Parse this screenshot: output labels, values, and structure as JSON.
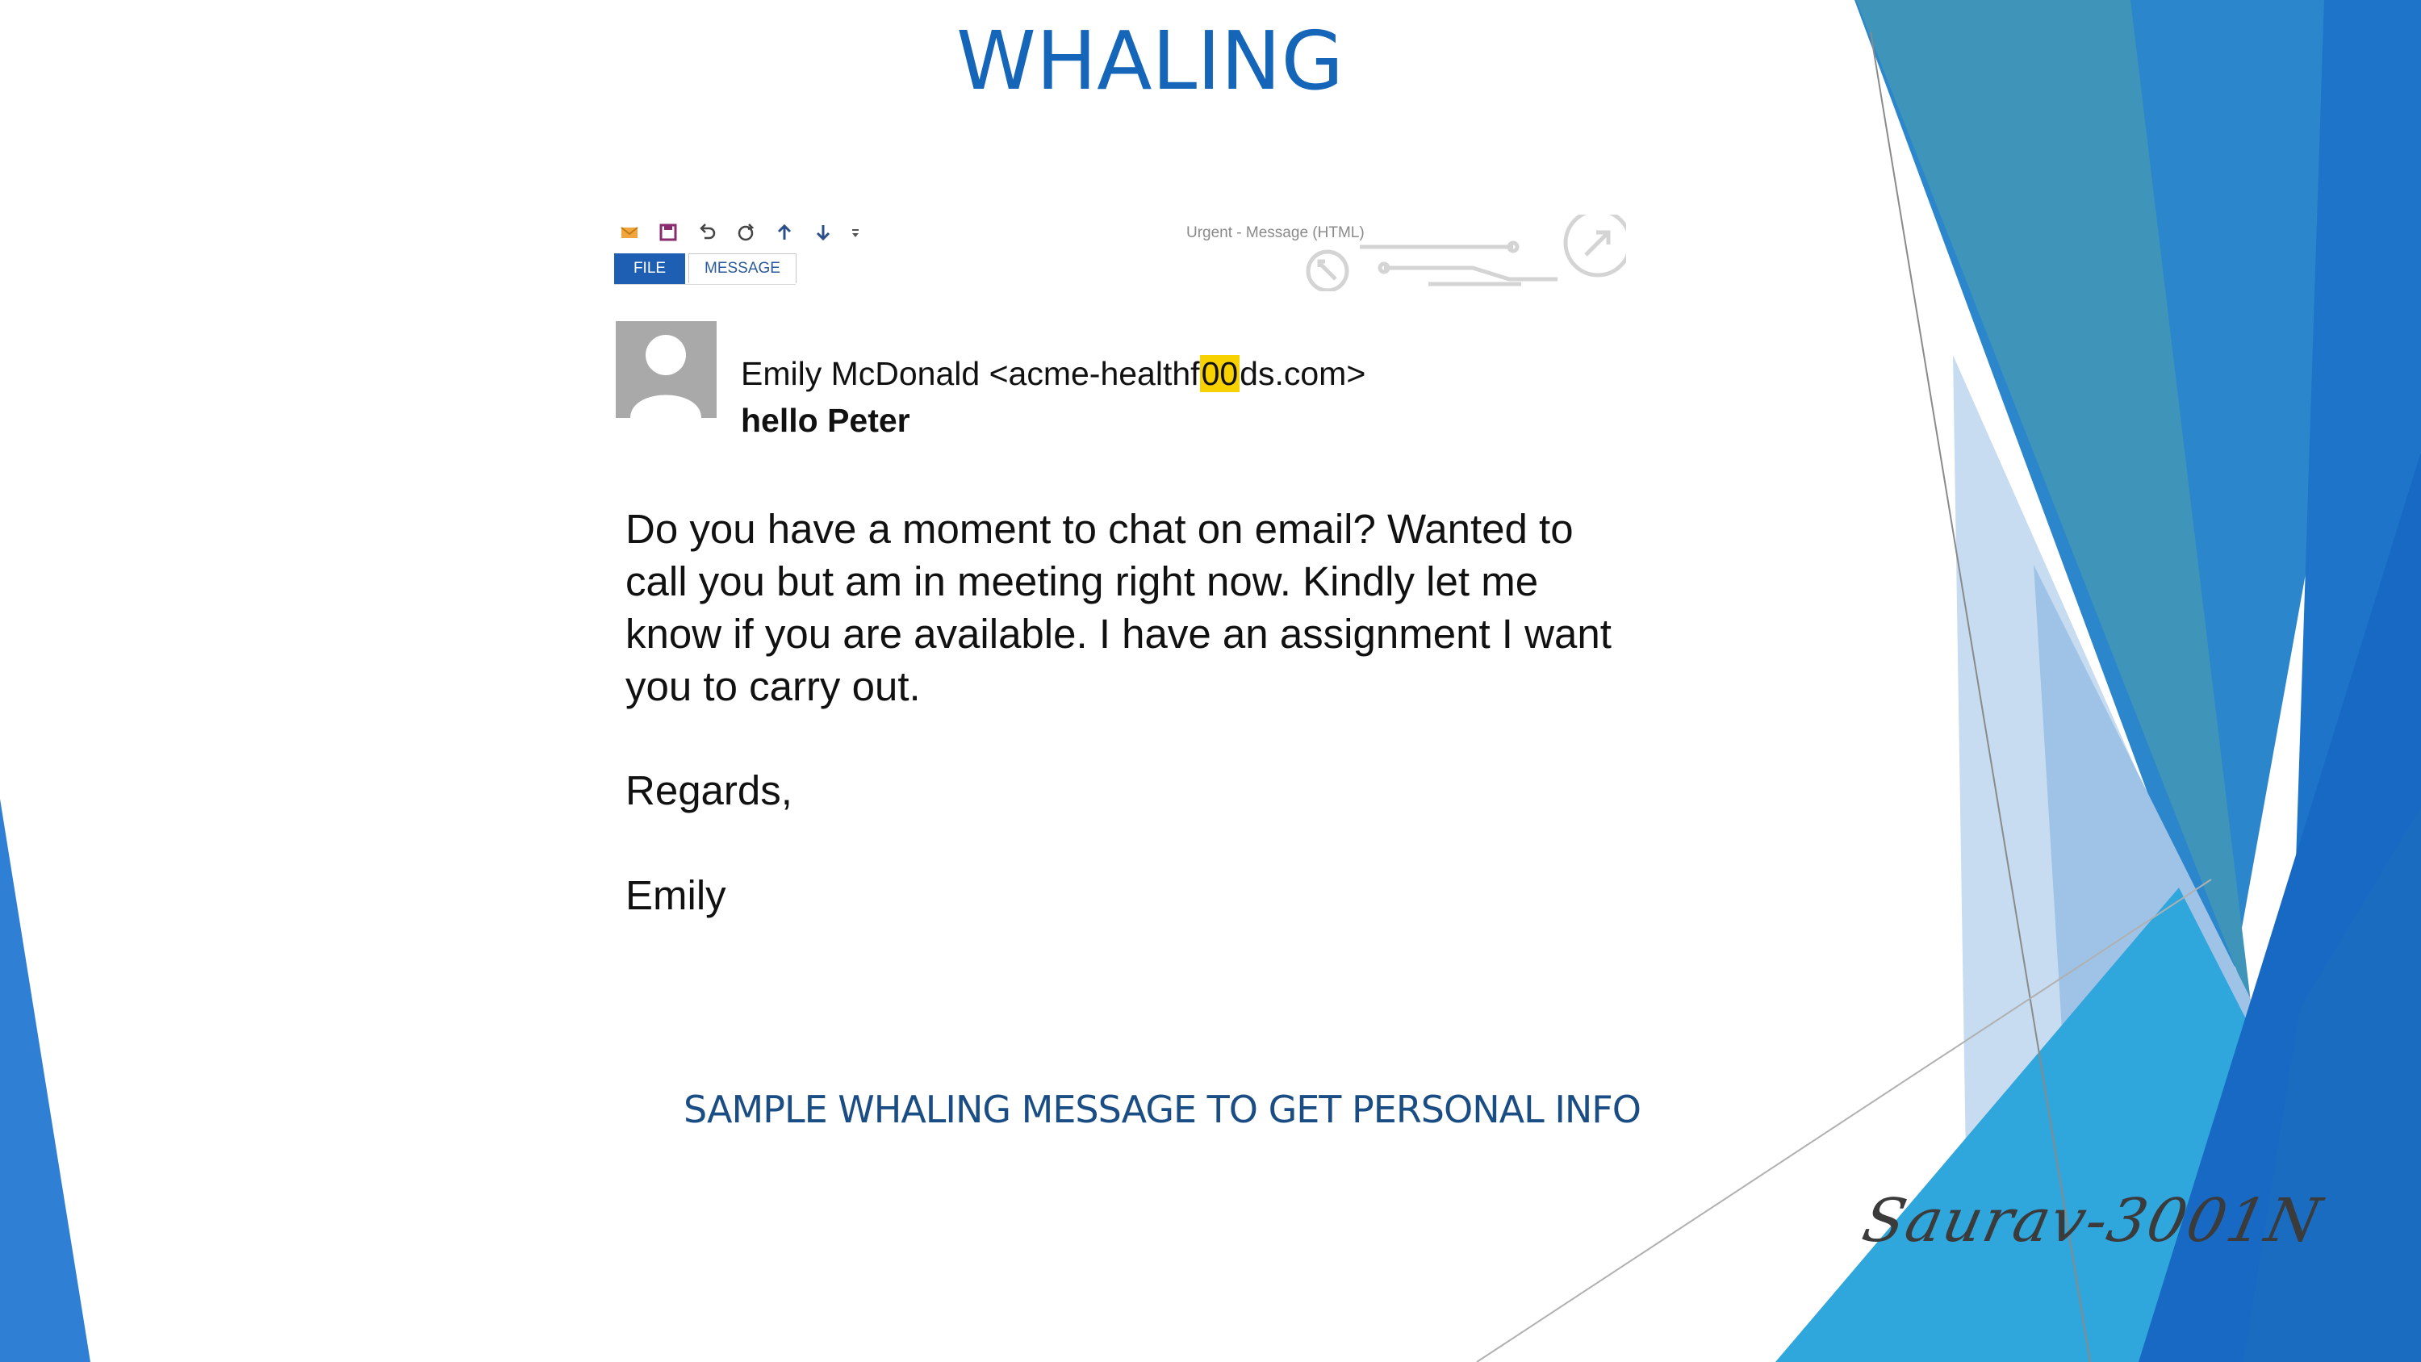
{
  "slide": {
    "title": "WHALING",
    "caption": "SAMPLE WHALING MESSAGE TO GET PERSONAL INFO",
    "author_signature": "Saurav-3001N"
  },
  "email_window": {
    "title": "Urgent - Message (HTML)",
    "quick_access_icons": [
      "mail-icon",
      "save-icon",
      "undo-icon",
      "redo-icon",
      "arrow-up-icon",
      "arrow-down-icon",
      "customize-toolbar-icon"
    ],
    "tabs": [
      {
        "label": "FILE",
        "active": true
      },
      {
        "label": "MESSAGE",
        "active": false
      }
    ]
  },
  "email": {
    "sender_name": "Emily McDonald",
    "address_before": " <acme-healthf",
    "address_highlight": "00",
    "address_after": "ds.com>",
    "subject": "hello Peter",
    "body_lines": [
      "Do you have a moment to chat on email? Wanted to",
      "call you but am in meeting right now. Kindly let me",
      "know if you are available. I have an assignment I want",
      "you to carry out."
    ],
    "regards": "Regards,",
    "signoff": "Emily"
  },
  "colors": {
    "title": "#1565b8",
    "caption": "#1a4d84",
    "highlight": "#f7d100",
    "file_tab": "#1f5fb3"
  }
}
